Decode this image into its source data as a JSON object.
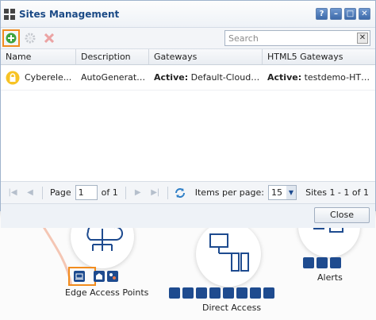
{
  "dialog": {
    "title": "Sites Management",
    "title_buttons": [
      "?",
      "–",
      "□",
      "✕"
    ],
    "toolbar": {
      "add_icon": "add-icon",
      "edit_icon": "gear-icon",
      "delete_icon": "delete-icon",
      "search_placeholder": "Search",
      "search_clear": "✕"
    },
    "grid": {
      "columns": [
        "Name",
        "Description",
        "Gateways",
        "HTML5 Gateways"
      ],
      "rows": [
        {
          "icon": "lock-icon",
          "name": "Cyberele...",
          "description": "AutoGenerated ...",
          "gateways_prefix": "Active:",
          "gateways_value": "Default-Cloud-Ed...",
          "html5_prefix": "Active:",
          "html5_value": "testdemo-HTML5..."
        }
      ]
    },
    "pager": {
      "page_label": "Page",
      "page_value": "1",
      "of_label": "of 1",
      "items_per_page_label": "Items per page:",
      "items_per_page_value": "15",
      "summary": "Sites 1 - 1 of 1"
    },
    "close_label": "Close"
  },
  "background": {
    "edge_label": "Edge Access Points",
    "direct_label": "Direct Access",
    "alerts_label": "Alerts"
  },
  "colors": {
    "accent": "#1e4b8f",
    "highlight": "#f28c1e",
    "alert_red": "#d9342b"
  }
}
